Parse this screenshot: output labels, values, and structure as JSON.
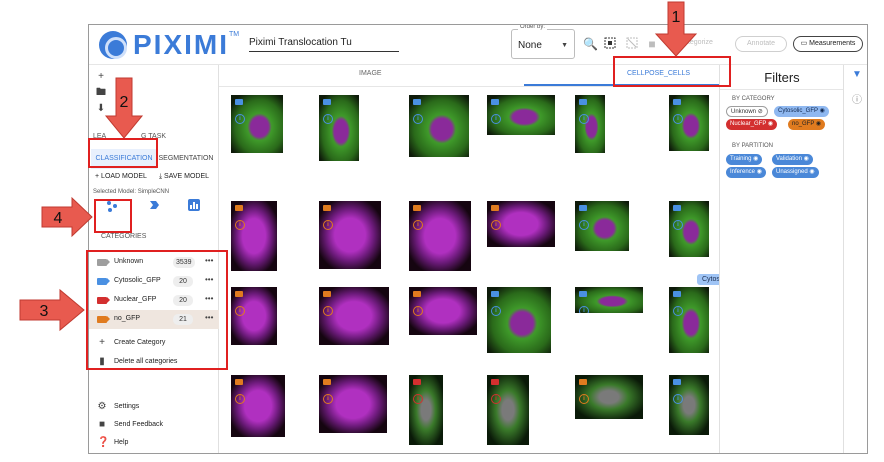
{
  "header": {
    "logo_text": "PIXIMI",
    "logo_tm": "TM",
    "project_name": "Piximi Translocation Tu",
    "order_by_label": "Order by:",
    "order_by_value": "None",
    "categorize_label": "Categorize",
    "annotate_label": "Annotate",
    "measurements_label": "Measurements"
  },
  "sidebar": {
    "learning_task_label": "LEARNING TASK",
    "learning_task_fragment_left": "LEA",
    "learning_task_fragment_right": "G TASK",
    "classification_tab": "CLASSIFICATION",
    "segmentation_tab": "SEGMENTATION",
    "load_model": "LOAD MODEL",
    "save_model": "SAVE MODEL",
    "selected_model": "Selected Model: SimpleCNN",
    "categories_label": "CATEGORIES",
    "categories": [
      {
        "name": "Unknown",
        "count": "3539",
        "color": "#9e9e9e"
      },
      {
        "name": "Cytosolic_GFP",
        "count": "20",
        "color": "#4a90e2"
      },
      {
        "name": "Nuclear_GFP",
        "count": "20",
        "color": "#d32f2f"
      },
      {
        "name": "no_GFP",
        "count": "21",
        "color": "#e07b1f"
      }
    ],
    "create_category": "Create Category",
    "delete_all": "Delete all categories",
    "settings": "Settings",
    "send_feedback": "Send Feedback",
    "help": "Help"
  },
  "main": {
    "tab_image": "IMAGE",
    "tab_cells": "CELLPOSE_CELLS",
    "tooltip": "Cytosolic_GFP"
  },
  "filters": {
    "title": "Filters",
    "by_category": "BY CATEGORY",
    "category_chips": [
      {
        "label": "Unknown",
        "bg": "#ffffff",
        "fg": "#333333",
        "border": "#9e9e9e"
      },
      {
        "label": "Cytosolic_GFP",
        "bg": "#8fb8f0",
        "fg": "#10284f",
        "border": "#8fb8f0"
      },
      {
        "label": "Nuclear_GFP",
        "bg": "#d32f2f",
        "fg": "#ffffff",
        "border": "#d32f2f"
      },
      {
        "label": "no_GFP",
        "bg": "#e07b1f",
        "fg": "#222222",
        "border": "#e07b1f"
      }
    ],
    "by_partition": "BY PARTITION",
    "partition_chips": [
      {
        "label": "Training",
        "bg": "#4a88d8",
        "fg": "#ffffff"
      },
      {
        "label": "Validation",
        "bg": "#4a88d8",
        "fg": "#ffffff"
      },
      {
        "label": "Inference",
        "bg": "#4a88d8",
        "fg": "#ffffff"
      },
      {
        "label": "Unassigned",
        "bg": "#4a88d8",
        "fg": "#ffffff"
      }
    ]
  },
  "annotations": {
    "labels": [
      "1",
      "2",
      "3",
      "4"
    ],
    "color": "#e02020"
  },
  "colors": {
    "accent": "#3b7bd8",
    "annotation_red": "#e02020"
  }
}
